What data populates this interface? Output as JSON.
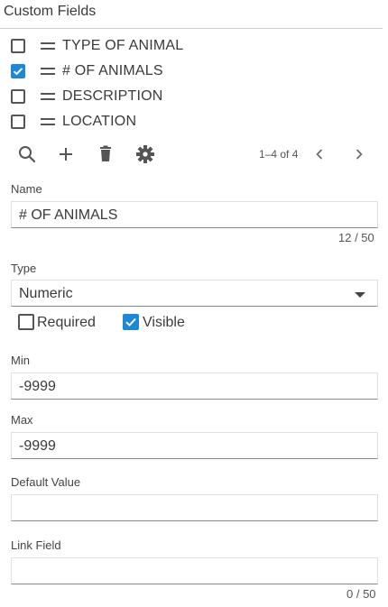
{
  "panel": {
    "title": "Custom Fields"
  },
  "fields": [
    {
      "label": "TYPE OF ANIMAL",
      "checked": false
    },
    {
      "label": "# OF ANIMALS",
      "checked": true
    },
    {
      "label": "DESCRIPTION",
      "checked": false
    },
    {
      "label": "LOCATION",
      "checked": false
    }
  ],
  "toolbar": {
    "search_icon": "search-icon",
    "add_icon": "plus-icon",
    "delete_icon": "trash-icon",
    "settings_icon": "gear-icon",
    "pager_text": "1–4 of 4",
    "prev_icon": "chevron-left-icon",
    "next_icon": "chevron-right-icon"
  },
  "form": {
    "name": {
      "label": "Name",
      "value": "# OF ANIMALS",
      "counter": "12 / 50"
    },
    "type": {
      "label": "Type",
      "value": "Numeric"
    },
    "required": {
      "label": "Required",
      "checked": false
    },
    "visible": {
      "label": "Visible",
      "checked": true
    },
    "min": {
      "label": "Min",
      "value": "-9999"
    },
    "max": {
      "label": "Max",
      "value": "-9999"
    },
    "default_value": {
      "label": "Default Value",
      "value": ""
    },
    "link_field": {
      "label": "Link Field",
      "value": "",
      "counter": "0 / 50"
    }
  },
  "colors": {
    "accent": "#1e88d6"
  }
}
